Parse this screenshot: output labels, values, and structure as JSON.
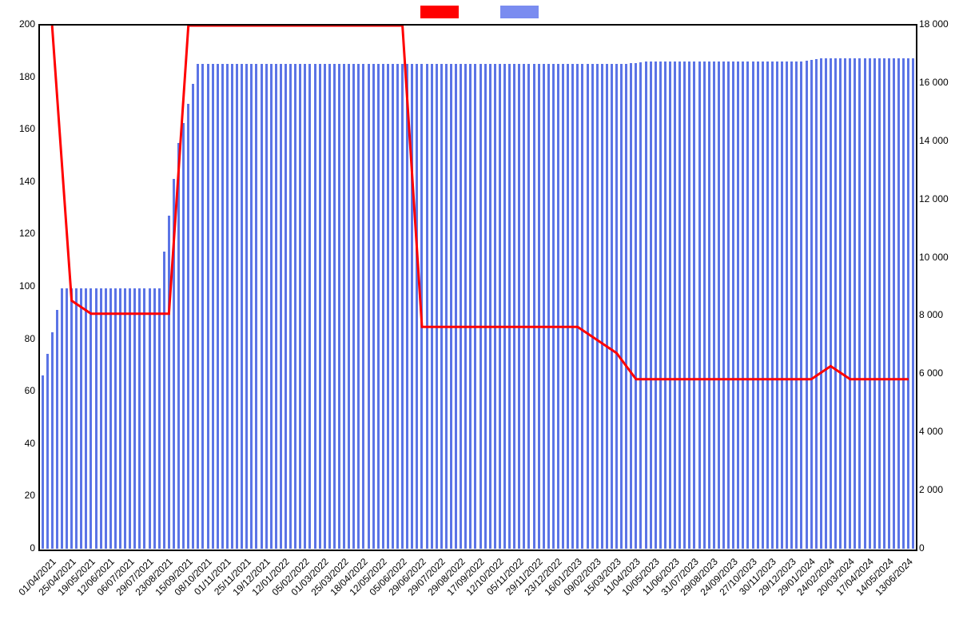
{
  "legend": {
    "series1": "",
    "series2": ""
  },
  "chart_data": {
    "type": "bar+line",
    "x_categories": [
      "01/04/2021",
      "25/04/2021",
      "19/05/2021",
      "12/06/2021",
      "06/07/2021",
      "29/07/2021",
      "23/08/2021",
      "15/09/2021",
      "08/10/2021",
      "01/11/2021",
      "25/11/2021",
      "19/12/2021",
      "12/01/2022",
      "05/02/2022",
      "01/03/2022",
      "25/03/2022",
      "18/04/2022",
      "12/05/2022",
      "05/06/2022",
      "29/06/2022",
      "29/07/2022",
      "29/08/2022",
      "17/09/2022",
      "12/10/2022",
      "05/11/2022",
      "29/11/2022",
      "23/12/2022",
      "16/01/2023",
      "09/02/2023",
      "15/03/2023",
      "11/04/2023",
      "10/05/2023",
      "11/06/2023",
      "31/07/2023",
      "29/08/2023",
      "24/09/2023",
      "27/10/2023",
      "30/11/2023",
      "29/12/2023",
      "29/01/2024",
      "24/02/2024",
      "20/03/2024",
      "17/04/2024",
      "14/05/2024",
      "13/06/2024"
    ],
    "y_left": {
      "label": "",
      "min": 0,
      "max": 200,
      "ticks": [
        0,
        20,
        40,
        60,
        80,
        100,
        120,
        140,
        160,
        180,
        200
      ]
    },
    "y_right": {
      "label": "",
      "min": 0,
      "max": 18000,
      "ticks": [
        0,
        2000,
        4000,
        6000,
        8000,
        10000,
        12000,
        14000,
        16000,
        18000
      ]
    },
    "series": [
      {
        "name": "red-line",
        "axis": "left",
        "color": "#ff0000",
        "type": "line",
        "values_per_tick": [
          200,
          95,
          90,
          90,
          90,
          90,
          90,
          200,
          200,
          200,
          200,
          200,
          200,
          200,
          200,
          200,
          200,
          200,
          200,
          85,
          85,
          85,
          85,
          85,
          85,
          85,
          85,
          85,
          80,
          75,
          65,
          65,
          65,
          65,
          65,
          65,
          65,
          65,
          65,
          65,
          70,
          65,
          65,
          65,
          65
        ],
        "note": "Estimated values read off the left axis at each x tick. First point is above 200 (clamped); step-like behaviour with small dips early, long plateau at 200, drop to ~85 mid-2022, further drop to ~65 from mid-2023, brief bump near early-2024."
      },
      {
        "name": "blue-bars",
        "axis": "right",
        "color": "#5b74e6",
        "type": "bar",
        "values_per_tick": [
          6000,
          9000,
          9000,
          9000,
          9000,
          9000,
          9000,
          14000,
          16700,
          16700,
          16700,
          16700,
          16700,
          16700,
          16700,
          16700,
          16700,
          16700,
          16700,
          16700,
          16700,
          16700,
          16700,
          16700,
          16700,
          16700,
          16700,
          16700,
          16700,
          16700,
          16700,
          16800,
          16800,
          16800,
          16800,
          16800,
          16800,
          16800,
          16800,
          16800,
          16900,
          16900,
          16900,
          16900,
          16900
        ],
        "note": "Estimated bar heights read off the right axis at each x tick. Bars start ~6000, rise to ~9000, jump to ~14000, then essentially saturate just under 17000 with very slight growth toward end."
      }
    ]
  }
}
